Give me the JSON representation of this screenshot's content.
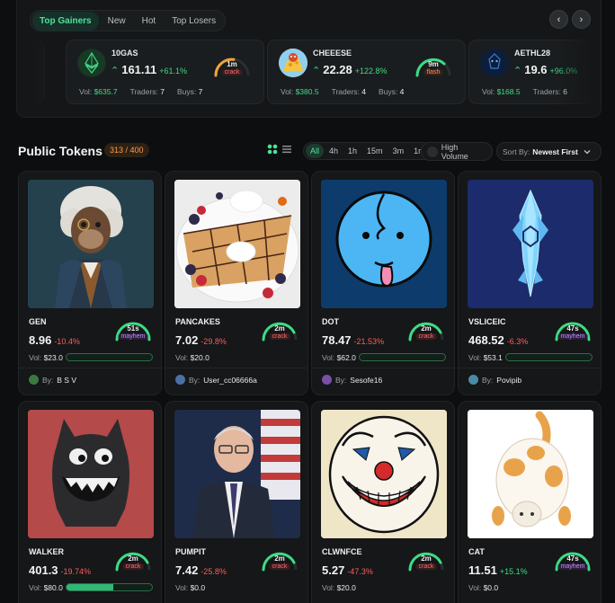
{
  "tabs": [
    "Top Gainers",
    "New",
    "Hot",
    "Top Losers"
  ],
  "nav": {
    "prev": "‹",
    "next": "›"
  },
  "gainers": [
    {
      "name": "10GAS",
      "price": "161.11",
      "change": "+61.1%",
      "time": "1m",
      "kind": "crack",
      "vol_label": "Vol:",
      "vol": "$635.7",
      "traders_label": "Traders:",
      "traders": "7",
      "buys_label": "Buys:",
      "buys": "7"
    },
    {
      "name": "CHEEESE",
      "price": "22.28",
      "change": "+122.8%",
      "time": "9m",
      "kind": "flash",
      "vol_label": "Vol:",
      "vol": "$380.5",
      "traders_label": "Traders:",
      "traders": "4",
      "buys_label": "Buys:",
      "buys": "4"
    },
    {
      "name": "AETHL28",
      "price": "19.6",
      "change": "+96.0%",
      "time": "",
      "kind": "",
      "vol_label": "Vol:",
      "vol": "$168.5",
      "traders_label": "Traders:",
      "traders": "6",
      "buys_label": "",
      "buys": ""
    }
  ],
  "section": {
    "title": "Public Tokens",
    "count": "313 / 400"
  },
  "time_filters": [
    "All",
    "4h",
    "1h",
    "15m",
    "3m",
    "1m"
  ],
  "high_volume": "High Volume",
  "sort": {
    "label": "Sort By:",
    "value": "Newest First"
  },
  "tokens": [
    {
      "name": "GEN",
      "price": "8.96",
      "change": "-10.4%",
      "dir": "neg",
      "time": "51s",
      "kind": "mayhem",
      "vol_label": "Vol:",
      "vol": "$23.0",
      "vol_fill": 0,
      "by_label": "By:",
      "creator": "B S V",
      "avatar_color": "#3b7a3f"
    },
    {
      "name": "PANCAKES",
      "price": "7.02",
      "change": "-29.8%",
      "dir": "neg",
      "time": "2m",
      "kind": "crack",
      "vol_label": "Vol:",
      "vol": "$20.0",
      "vol_fill": 0,
      "by_label": "By:",
      "creator": "User_cc06666a",
      "avatar_color": "#4a6fa5"
    },
    {
      "name": "DOT",
      "price": "78.47",
      "change": "-21.53%",
      "dir": "neg",
      "time": "2m",
      "kind": "crack",
      "vol_label": "Vol:",
      "vol": "$62.0",
      "vol_fill": 0,
      "by_label": "By:",
      "creator": "Sesofe16",
      "avatar_color": "#7a4fa5"
    },
    {
      "name": "VSLICEIC",
      "price": "468.52",
      "change": "-6.3%",
      "dir": "neg",
      "time": "47s",
      "kind": "mayhem",
      "vol_label": "Vol:",
      "vol": "$53.1",
      "vol_fill": 0,
      "by_label": "By:",
      "creator": "Povipib",
      "avatar_color": "#4a8aa5"
    },
    {
      "name": "WALKER",
      "price": "401.3",
      "change": "-19.74%",
      "dir": "neg",
      "time": "2m",
      "kind": "crack",
      "vol_label": "Vol:",
      "vol": "$80.0",
      "vol_fill": 0.55
    },
    {
      "name": "PUMPIT",
      "price": "7.42",
      "change": "-25.8%",
      "dir": "neg",
      "time": "2m",
      "kind": "crack",
      "vol_label": "Vol:",
      "vol": "$0.0",
      "vol_fill": 0
    },
    {
      "name": "CLWNFCE",
      "price": "5.27",
      "change": "-47.3%",
      "dir": "neg",
      "time": "2m",
      "kind": "crack",
      "vol_label": "Vol:",
      "vol": "$20.0",
      "vol_fill": 0
    },
    {
      "name": "CAT",
      "price": "11.51",
      "change": "+15.1%",
      "dir": "pos",
      "time": "47s",
      "kind": "mayhem",
      "vol_label": "Vol:",
      "vol": "$0.0",
      "vol_fill": 0
    }
  ],
  "icons": {
    "up": "up-arrow-icon",
    "grid": "grid-view-icon",
    "list": "list-view-icon",
    "chevron": "chevron-down-icon"
  },
  "colors": {
    "accent_green": "#3ddc84",
    "negative": "#ff5c5c",
    "count_badge": "#ff9d4a"
  }
}
